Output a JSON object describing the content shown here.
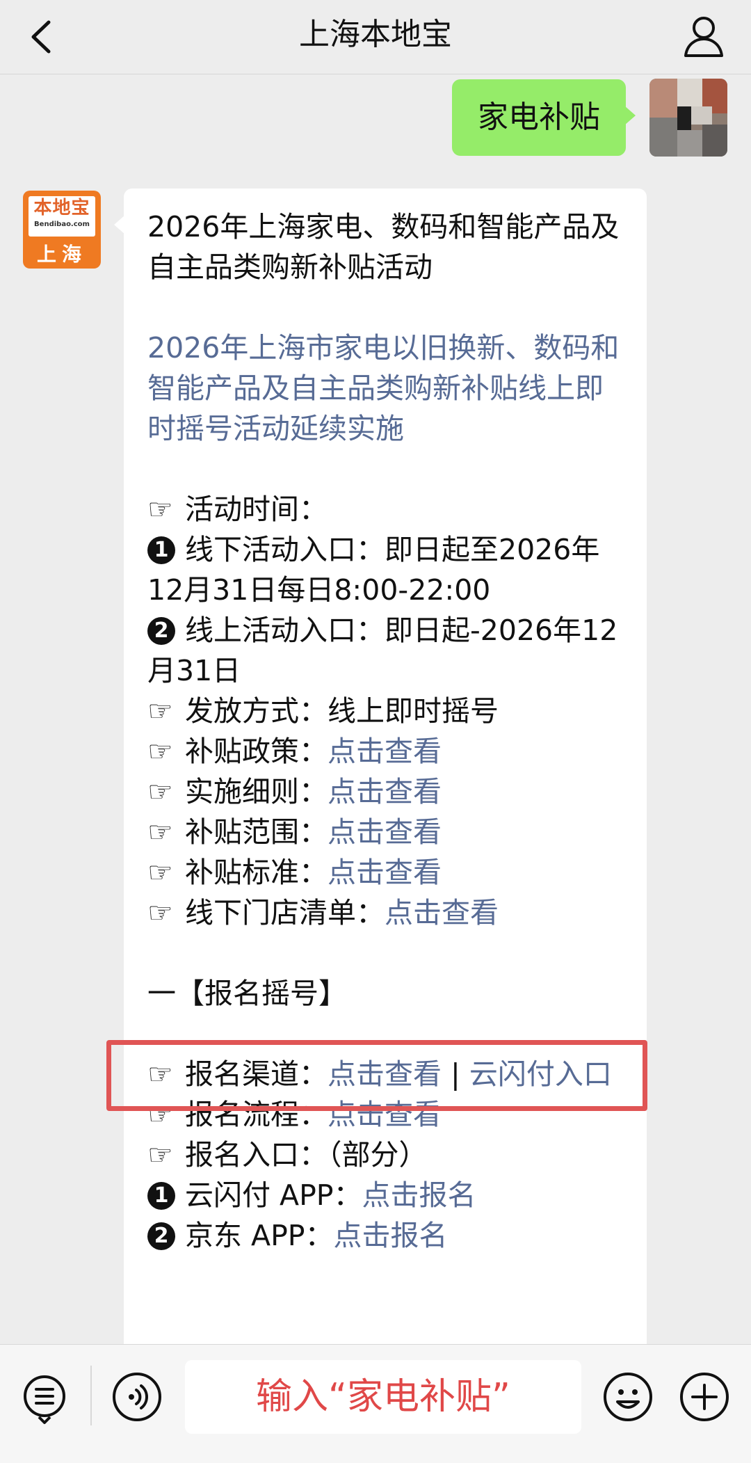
{
  "header": {
    "title": "上海本地宝"
  },
  "user_message": {
    "text": "家电补贴"
  },
  "bot": {
    "avatar": {
      "logo_cn": "本地宝",
      "logo_en": "Bendibao.com",
      "city": "上海"
    },
    "title": "2026年上海家电、数码和智能产品及自主品类购新补贴活动",
    "subtitle_link": "2026年上海市家电以旧换新、数码和智能产品及自主品类购新补贴线上即时摇号活动延续实施",
    "hand_icon": "☞",
    "activity_time_label": "活动时间：",
    "offline_label": "线下活动入口：",
    "offline_value": "即日起至2026年12月31日每日8:00-22:00",
    "online_label": "线上活动入口：",
    "online_value": "即日起-2026年12月31日",
    "method_label": "发放方式：",
    "method_value": "线上即时摇号",
    "links": [
      {
        "label": "补贴政策：",
        "link": "点击查看"
      },
      {
        "label": "实施细则：",
        "link": "点击查看"
      },
      {
        "label": "补贴范围：",
        "link": "点击查看"
      },
      {
        "label": "补贴标准：",
        "link": "点击查看"
      },
      {
        "label": "线下门店清单：",
        "link": "点击查看"
      }
    ],
    "section_title": "一【报名摇号】",
    "channel_label": "报名渠道：",
    "channel_link1": "点击查看",
    "channel_sep": "|",
    "channel_link2": "云闪付入口",
    "process_label": "报名流程：",
    "process_link": "点击查看",
    "entry_label": "报名入口：",
    "entry_note": "（部分）",
    "entry1_label": "云闪付 APP：",
    "entry1_link": "点击报名",
    "entry2_label": "京东 APP：",
    "entry2_link": "点击报名"
  },
  "input": {
    "text": "输入“家电补贴”"
  },
  "numbers": {
    "n1": "1",
    "n2": "2"
  }
}
